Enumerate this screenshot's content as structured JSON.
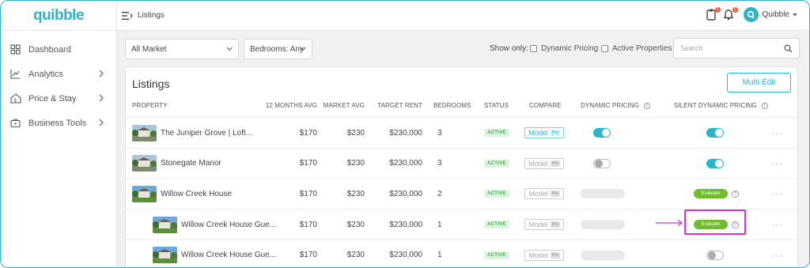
{
  "app": {
    "logo": "quibble"
  },
  "sidebar": {
    "items": [
      {
        "label": "Dashboard",
        "icon": "grid-icon",
        "has_chevron": false
      },
      {
        "label": "Analytics",
        "icon": "chart-icon",
        "has_chevron": true
      },
      {
        "label": "Price & Stay",
        "icon": "house-dollar-icon",
        "has_chevron": true
      },
      {
        "label": "Business Tools",
        "icon": "briefcase-icon",
        "has_chevron": true
      }
    ]
  },
  "header": {
    "title": "Listings",
    "user_name": "Quibble",
    "notification_counts": [
      "1",
      "1"
    ]
  },
  "filters": {
    "market": "All Market",
    "bedrooms": "Bedrooms: Any",
    "show_only": "Show only:",
    "dynamic_pricing": "Dynamic Pricing",
    "active_properties": "Active Properties",
    "search_placeholder": "Search"
  },
  "listings": {
    "title": "Listings",
    "multi_edit": "Multi-Edit",
    "columns": [
      "PROPERTY",
      "12 MONTHS AVG",
      "MARKET AVG",
      "TARGET RENT",
      "BEDROOMS",
      "STATUS",
      "COMPARE",
      "DYNAMIC PRICING",
      "SILENT DYNAMIC PRICING"
    ],
    "rows": [
      {
        "name": "The Juniper Grove | Loft...",
        "avg12": "$170",
        "market_avg": "$230",
        "target_rent": "$230,000",
        "bedrooms": "3",
        "status": "ACTIVE",
        "compare": "Model",
        "pro": "Pro",
        "compare_active": true,
        "dynamic_pricing": "on",
        "silent": "on",
        "indent": false
      },
      {
        "name": "Stonegate Manor",
        "avg12": "$170",
        "market_avg": "$230",
        "target_rent": "$230,000",
        "bedrooms": "3",
        "status": "ACTIVE",
        "compare": "Model",
        "pro": "Pro",
        "compare_active": false,
        "dynamic_pricing": "off",
        "silent": "on",
        "indent": false
      },
      {
        "name": "Willow Creek House",
        "avg12": "$170",
        "market_avg": "$230",
        "target_rent": "$230,000",
        "bedrooms": "2",
        "status": "ACTIVE",
        "compare": "Model",
        "pro": "Pro",
        "compare_active": false,
        "dynamic_pricing": "none",
        "silent": "evaluate",
        "indent": false
      },
      {
        "name": "Willow Creek House Gue...",
        "avg12": "$170",
        "market_avg": "$230",
        "target_rent": "$230,000",
        "bedrooms": "1",
        "status": "ACTIVE",
        "compare": "Model",
        "pro": "Pro",
        "compare_active": false,
        "dynamic_pricing": "none",
        "silent": "evaluate",
        "indent": true
      },
      {
        "name": "Willow Creek House Gue...",
        "avg12": "$170",
        "market_avg": "$230",
        "target_rent": "$230,000",
        "bedrooms": "1",
        "status": "ACTIVE",
        "compare": "Model",
        "pro": "Pro",
        "compare_active": false,
        "dynamic_pricing": "none",
        "silent": "off",
        "indent": true
      }
    ],
    "evaluate_label": "Evaluate"
  },
  "colors": {
    "accent": "#2cb4c7",
    "active_green": "#49ad57",
    "evaluate_green": "#6fbe2f",
    "highlight": "#e52ad6"
  }
}
